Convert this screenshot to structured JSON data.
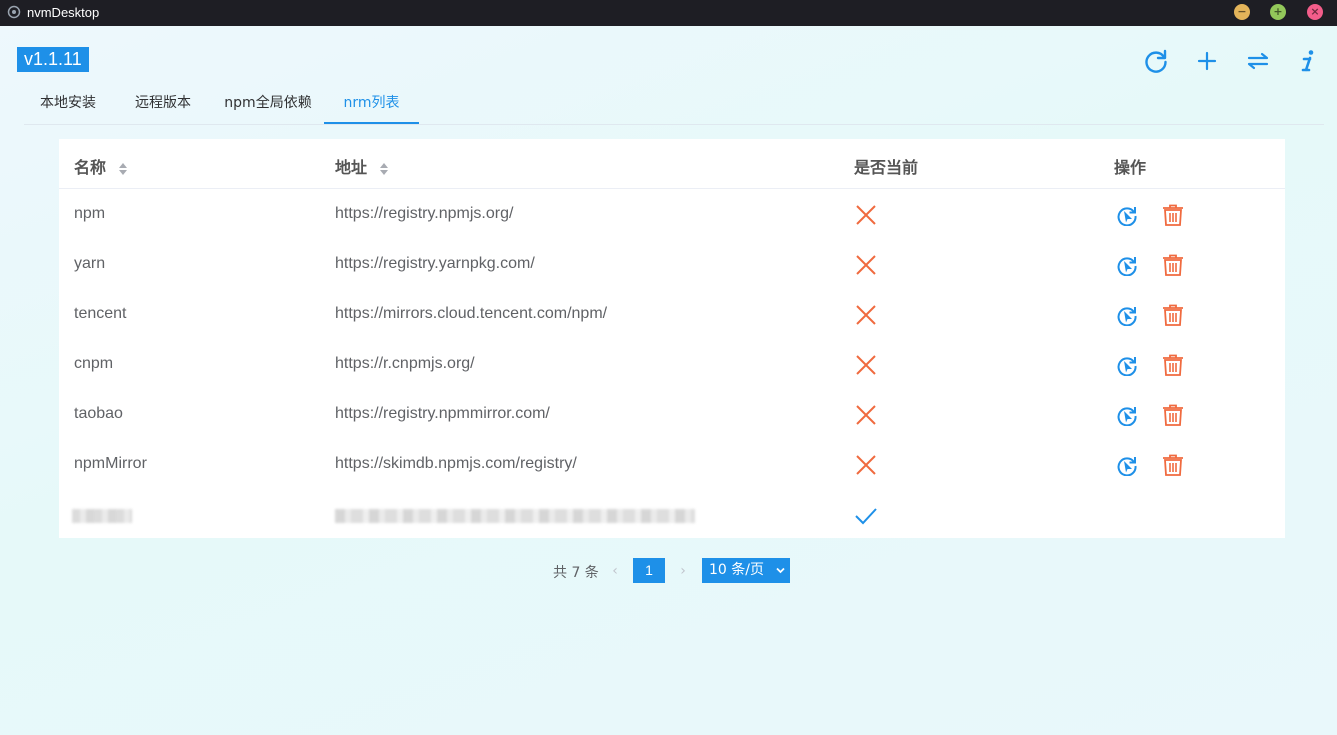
{
  "window": {
    "title": "nvmDesktop"
  },
  "header": {
    "version": "v1.1.11"
  },
  "tabs": [
    {
      "label": "本地安装",
      "active": false
    },
    {
      "label": "远程版本",
      "active": false
    },
    {
      "label": "npm全局依赖",
      "active": false
    },
    {
      "label": "nrm列表",
      "active": true
    }
  ],
  "table": {
    "columns": [
      "名称",
      "地址",
      "是否当前",
      "操作"
    ],
    "rows": [
      {
        "name": "npm",
        "address": "https://registry.npmjs.org/",
        "current": false
      },
      {
        "name": "yarn",
        "address": "https://registry.yarnpkg.com/",
        "current": false
      },
      {
        "name": "tencent",
        "address": "https://mirrors.cloud.tencent.com/npm/",
        "current": false
      },
      {
        "name": "cnpm",
        "address": "https://r.cnpmjs.org/",
        "current": false
      },
      {
        "name": "taobao",
        "address": "https://registry.npmmirror.com/",
        "current": false
      },
      {
        "name": "npmMirror",
        "address": "https://skimdb.npmjs.com/registry/",
        "current": false
      },
      {
        "name": "",
        "address": "",
        "current": true
      }
    ]
  },
  "pagination": {
    "total": "共 7 条",
    "current_page": "1",
    "page_size": "10 条/页"
  },
  "colors": {
    "accent": "#1e90e8",
    "danger": "#f06a3f",
    "titlebar": "#1e1e24"
  },
  "icons": {
    "toolbar": [
      "refresh-icon",
      "add-icon",
      "switch-icon",
      "info-icon"
    ],
    "row_actions": [
      "use-registry-icon",
      "delete-icon"
    ],
    "status": [
      "cross-icon",
      "check-icon"
    ]
  }
}
